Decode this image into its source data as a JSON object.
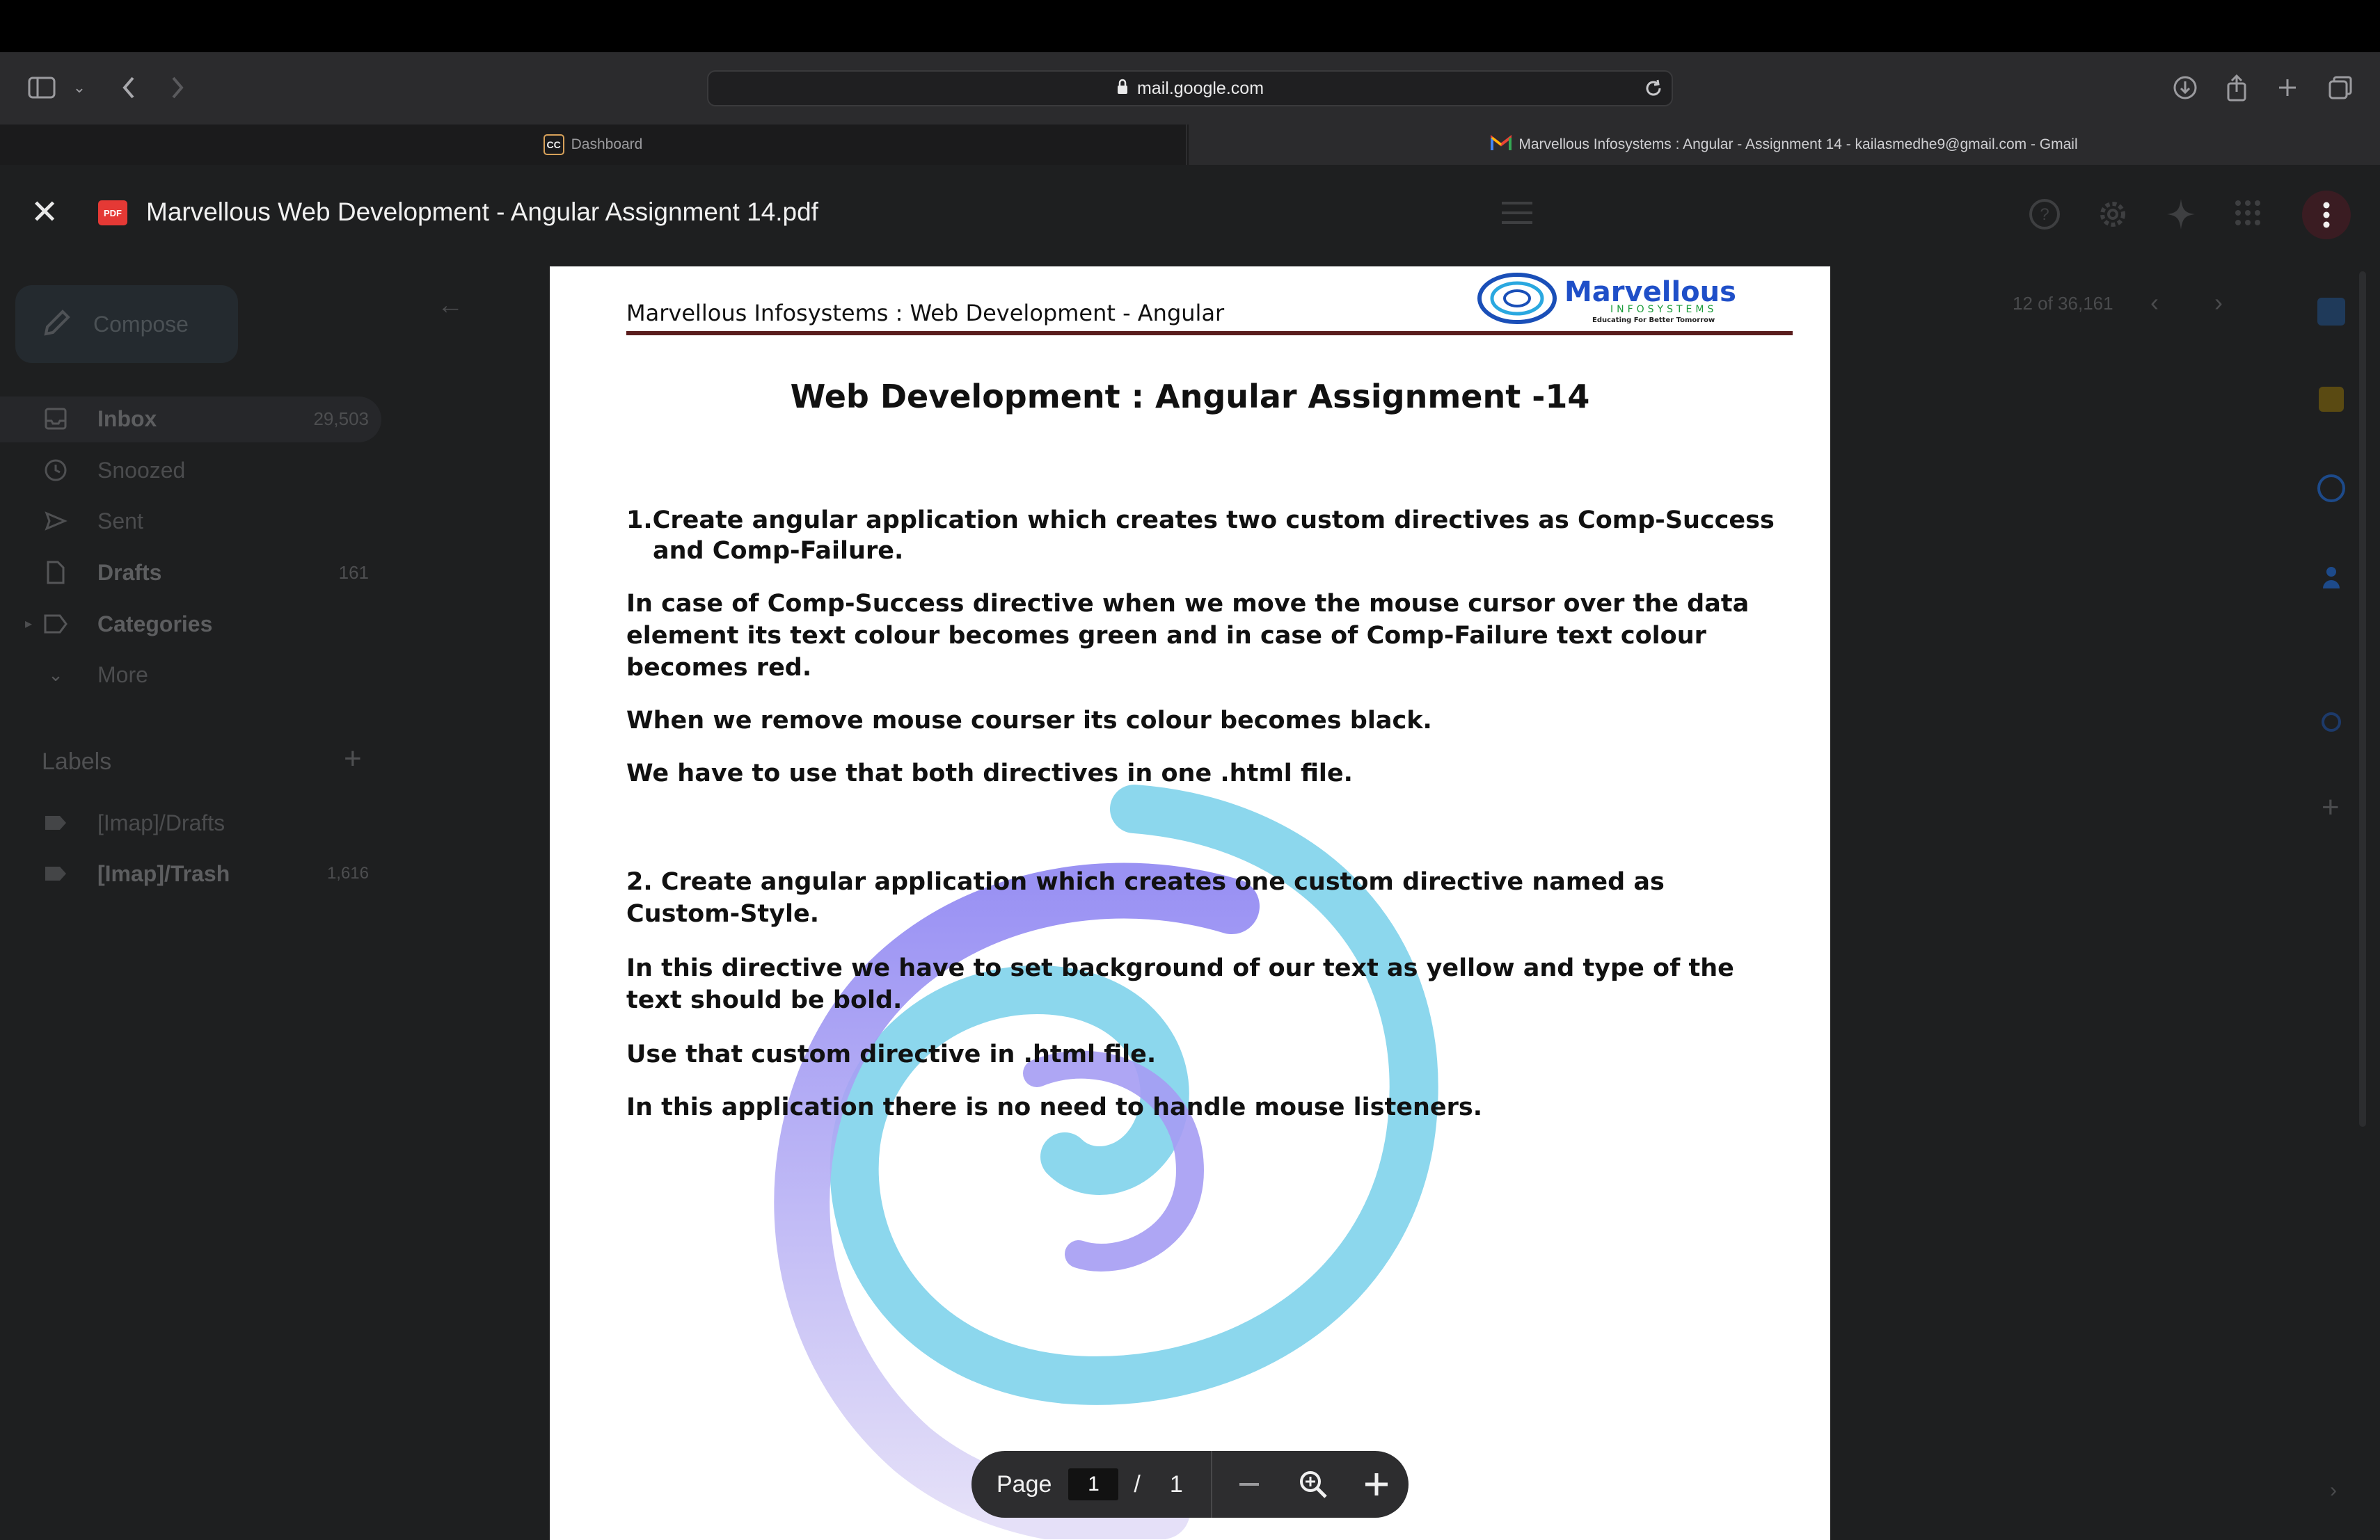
{
  "browser": {
    "url": "mail.google.com",
    "tabs": [
      {
        "label": "Dashboard",
        "favicon": "CC"
      },
      {
        "label": "Marvellous Infosystems : Angular - Assignment 14 - kailasmedhe9@gmail.com - Gmail"
      }
    ]
  },
  "viewer": {
    "file_name": "Marvellous Web Development - Angular Assignment 14.pdf",
    "pdf_badge": "PDF"
  },
  "gmail": {
    "compose_label": "Compose",
    "nav": [
      {
        "label": "Inbox",
        "count": "29,503"
      },
      {
        "label": "Snoozed",
        "count": ""
      },
      {
        "label": "Sent",
        "count": ""
      },
      {
        "label": "Drafts",
        "count": "161"
      },
      {
        "label": "Categories",
        "count": ""
      },
      {
        "label": "More",
        "count": ""
      }
    ],
    "labels_heading": "Labels",
    "labels": [
      {
        "label": "[Imap]/Drafts",
        "count": ""
      },
      {
        "label": "[Imap]/Trash",
        "count": "1,616"
      }
    ],
    "pagination": "12 of 36,161"
  },
  "document": {
    "header_text": "Marvellous Infosystems : Web Development - Angular",
    "logo_text": "Marvellous",
    "logo_sub": "INFOSYSTEMS",
    "logo_tagline": "Educating For Better Tomorrow",
    "title": "Web Development : Angular Assignment -14",
    "q1_line1": "1.Create angular application which creates two custom directives as Comp-Success",
    "q1_line2": "and Comp-Failure.",
    "q1_p2": "In case of Comp-Success directive when we move the mouse cursor over the data element its text colour becomes green and in case of Comp-Failure text colour becomes red.",
    "q1_p3": "When we remove mouse courser its colour becomes black.",
    "q1_p4": "We have to use that both directives in one .html file.",
    "q2_p1": "2. Create angular application which creates one custom directive named as Custom-Style.",
    "q2_p2": "In this directive we have to set background of our text as yellow and type of the text should be bold.",
    "q2_p3": "Use that custom directive in .html file.",
    "q2_p4": "In this application there is no need to handle mouse listeners."
  },
  "page_controls": {
    "page_label": "Page",
    "current_page": "1",
    "separator": "/",
    "total_pages": "1"
  }
}
